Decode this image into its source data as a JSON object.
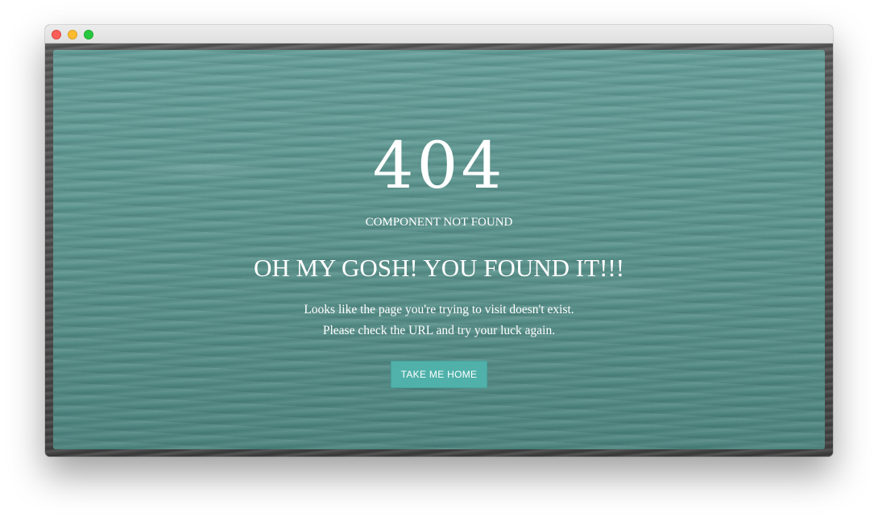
{
  "window": {
    "controls": [
      "close-button",
      "minimize-button",
      "maximize-button"
    ]
  },
  "error": {
    "code": "404",
    "subtitle": "COMPONENT NOT FOUND",
    "headline": "OH MY GOSH! YOU FOUND IT!!!",
    "message_line1": "Looks like the page you're trying to visit doesn't exist.",
    "message_line2": "Please check the URL and try your luck again.",
    "button_label": "TAKE ME HOME"
  },
  "colors": {
    "water": "#5b928c",
    "button": "#4fb1aa",
    "text": "#ffffff"
  }
}
